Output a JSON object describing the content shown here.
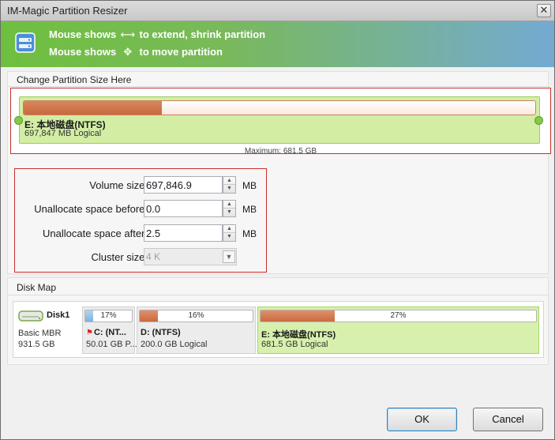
{
  "window": {
    "title": "IM-Magic Partition Resizer",
    "close_glyph": "✕"
  },
  "banner": {
    "line1_pre": "Mouse shows",
    "line1_glyph": "⟷",
    "line1_post": "to extend, shrink partition",
    "line2_pre": "Mouse shows",
    "line2_glyph": "✥",
    "line2_post": "to move partition",
    "icon": "disk-resize-icon"
  },
  "resize_section": {
    "title": "Change Partition Size Here",
    "partition": {
      "name": "E: 本地磁盘(NTFS)",
      "sub": "697,847 MB Logical",
      "used_fraction": 0.27
    },
    "maximum_label": "Maximum: 681.5 GB"
  },
  "fields": {
    "volume_size": {
      "label": "Volume size:",
      "value": "697,846.9",
      "unit": "MB"
    },
    "unalloc_before": {
      "label": "Unallocate space before:",
      "value": "0.0",
      "unit": "MB"
    },
    "unalloc_after": {
      "label": "Unallocate space after:",
      "value": "2.5",
      "unit": "MB"
    },
    "cluster_size": {
      "label": "Cluster size:",
      "value": "4 K"
    }
  },
  "disk_map": {
    "title": "Disk Map",
    "disk": {
      "name": "Disk1",
      "type": "Basic MBR",
      "size": "931.5 GB",
      "icon": "hard-disk-icon"
    },
    "partitions": [
      {
        "pct_label": "17%",
        "used": 0.17,
        "name": "C: (NT...",
        "sub": "50.01 GB P...",
        "flag": "🚩",
        "color": "#7fb1e0",
        "selected": false
      },
      {
        "pct_label": "16%",
        "used": 0.16,
        "name": "D: (NTFS)",
        "sub": "200.0 GB Logical",
        "color": "#c96a40",
        "selected": false
      },
      {
        "pct_label": "27%",
        "used": 0.27,
        "name": "E: 本地磁盘(NTFS)",
        "sub": "681.5 GB Logical",
        "color": "#c96a40",
        "selected": true
      }
    ]
  },
  "buttons": {
    "ok": "OK",
    "cancel": "Cancel"
  },
  "colors": {
    "banner_green": "#6fbf3f",
    "banner_blue": "#74aad3",
    "highlight_red": "#c9302c",
    "partition_green": "#d3eea4",
    "bar_orange": "#c86a3e"
  }
}
